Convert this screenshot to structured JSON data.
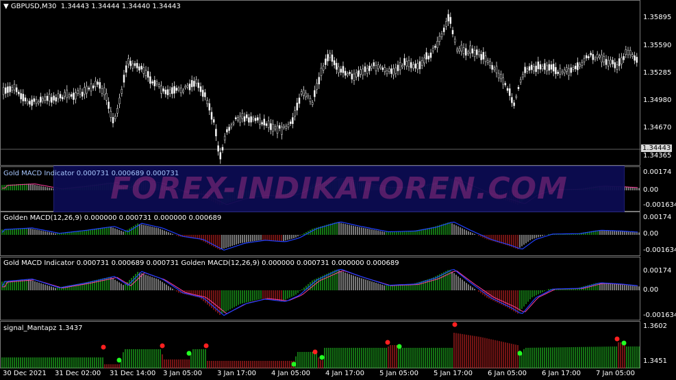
{
  "main": {
    "symbol": "GBPUSD,M30",
    "ohlc": "1.34443 1.34444 1.34440 1.34443",
    "price_scale": [
      "1.35895",
      "1.35590",
      "1.35285",
      "1.34980",
      "1.34670",
      "1.34365"
    ],
    "current_price": "1.34443"
  },
  "watermark": "FOREX-INDIKATOREN.COM",
  "pane1": {
    "title": "Gold MACD Indicator 0.000731 0.000689 0.000731",
    "scale": [
      "0.00174",
      "0.00",
      "-0.001634"
    ]
  },
  "pane2": {
    "title": "Golden MACD(12,26,9) 0.000000 0.000731 0.000000 0.000689",
    "scale": [
      "0.00174",
      "0.00",
      "-0.001634"
    ]
  },
  "pane3": {
    "title": "Gold MACD Indicator 0.000731 0.000689 0.000731  Golden MACD(12,26,9) 0.000000 0.000731 0.000000 0.000689",
    "scale": [
      "0.00174",
      "0.00",
      "-0.001634"
    ]
  },
  "pane4": {
    "title": "signal_Mantapz 1.3437",
    "scale": [
      "1.3602",
      "1.3451"
    ]
  },
  "time_axis": [
    "30 Dec 2021",
    "31 Dec 02:00",
    "31 Dec 14:00",
    "3 Jan 05:00",
    "3 Jan 17:00",
    "4 Jan 05:00",
    "4 Jan 17:00",
    "5 Jan 05:00",
    "5 Jan 17:00",
    "6 Jan 05:00",
    "6 Jan 17:00",
    "7 Jan 05:00"
  ],
  "colors": {
    "bull": "#22c022",
    "bear": "#c02222",
    "neutral": "#c8c8c8",
    "signal": "#ff3ea0",
    "macd": "#2040ff",
    "up_dot": "#22ff22",
    "down_dot": "#ff2020"
  }
}
